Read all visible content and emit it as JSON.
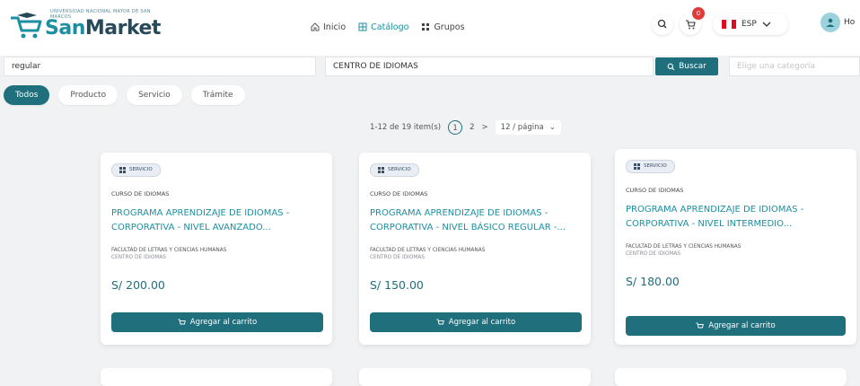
{
  "brand": {
    "tagline": "UNIVERSIDAD NACIONAL MAYOR DE SAN MARCOS",
    "name_part1": "San",
    "name_part2": "Market"
  },
  "nav": [
    {
      "label": "Inicio",
      "icon": "home-icon"
    },
    {
      "label": "Catálogo",
      "icon": "catalog-icon"
    },
    {
      "label": "Grupos",
      "icon": "groups-icon"
    }
  ],
  "cart_count": "0",
  "language": "ESP",
  "user_label": "Ho",
  "search": {
    "query": "regular",
    "unit": "CENTRO DE IDIOMAS",
    "button_label": "Buscar",
    "category_placeholder": "Elige una categoría"
  },
  "filters": [
    "Todos",
    "Producto",
    "Servicio",
    "Trámite"
  ],
  "pagination": {
    "range": "1-12 de 19 item(s)",
    "current": "1",
    "next_page": "2",
    "next_arrow": ">",
    "page_size": "12 / página"
  },
  "cards": [
    {
      "type": "SERVICIO",
      "category": "CURSO DE IDIOMAS",
      "title": "PROGRAMA APRENDIZAJE DE IDIOMAS - CORPORATIVA - NIVEL AVANZADO...",
      "faculty": "FACULTAD DE LETRAS Y CIENCIAS HUMANAS",
      "unit": "CENTRO DE IDIOMAS",
      "price": "S/ 200.00",
      "button": "Agregar al carrito"
    },
    {
      "type": "SERVICIO",
      "category": "CURSO DE IDIOMAS",
      "title": "PROGRAMA APRENDIZAJE DE IDIOMAS - CORPORATIVA - NIVEL BÁSICO REGULAR -...",
      "faculty": "FACULTAD DE LETRAS Y CIENCIAS HUMANAS",
      "unit": "CENTRO DE IDIOMAS",
      "price": "S/ 150.00",
      "button": "Agregar al carrito"
    },
    {
      "type": "SERVICIO",
      "category": "CURSO DE IDIOMAS",
      "title": "PROGRAMA APRENDIZAJE DE IDIOMAS - CORPORATIVA - NIVEL INTERMEDIO...",
      "faculty": "FACULTAD DE LETRAS Y CIENCIAS HUMANAS",
      "unit": "CENTRO DE IDIOMAS",
      "price": "S/ 180.00",
      "button": "Agregar al carrito"
    }
  ],
  "colors": {
    "primary": "#1f6f7c",
    "accent": "#1c8fa0",
    "badge": "#e03b3b"
  }
}
